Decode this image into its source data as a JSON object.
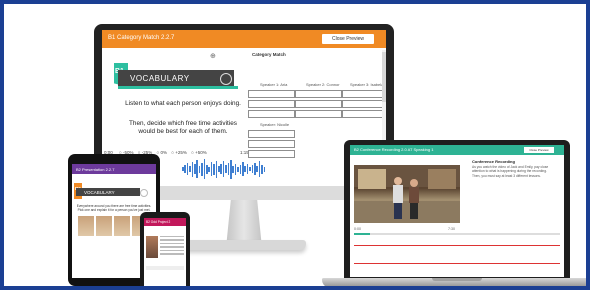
{
  "monitor": {
    "title": "B1 Category Match 2.2.7",
    "close_label": "Close Preview",
    "zoom_icon": "zoom-in-icon",
    "badge": "B1",
    "vocab_word": "VOCABULARY",
    "prompt": "Listen to what each person enjoys doing.",
    "instruction": "Then, decide which free time activities would be best for each of them.",
    "audio": {
      "start_time": "0:00",
      "options": [
        "-50%",
        "-25%",
        "0%",
        "+25%",
        "+50%"
      ],
      "end_time": "1:15"
    },
    "category_title": "Category Match",
    "speakers": [
      "Speaker 1: Aria",
      "Speaker 2: Connor",
      "Speaker 3: Isabela"
    ],
    "speaker_bottom": "Speaker: Nicolle"
  },
  "laptop": {
    "title": "B2 Conference Recording 2.0 AT Speaking 1",
    "close_label": "Close Preview",
    "right_title": "Conference Recording",
    "right_text": "As you watch the video of Jack and Emily, pay close attention to what is happening during the recording. Then, you must say at least 3 different lessons.",
    "time_start": "0:00",
    "time_end": "7:30",
    "progress": 0.08
  },
  "tablet": {
    "title": "B2 Presentation 2.2.7",
    "badge": "B2",
    "vocab_word": "VOCABULARY",
    "text": "Everywhere around you there are free time activities. Pick one and explain it for a person you've just met."
  },
  "phone": {
    "title": "B2 Odd Project 2"
  },
  "colors": {
    "monitor_bar": "#f08a24",
    "laptop_bar": "#2eb394",
    "tablet_bar": "#6d3a9c",
    "phone_bar": "#c2185b",
    "background_border": "#1b3f93",
    "vocab_accent": "#2dbfa0"
  }
}
